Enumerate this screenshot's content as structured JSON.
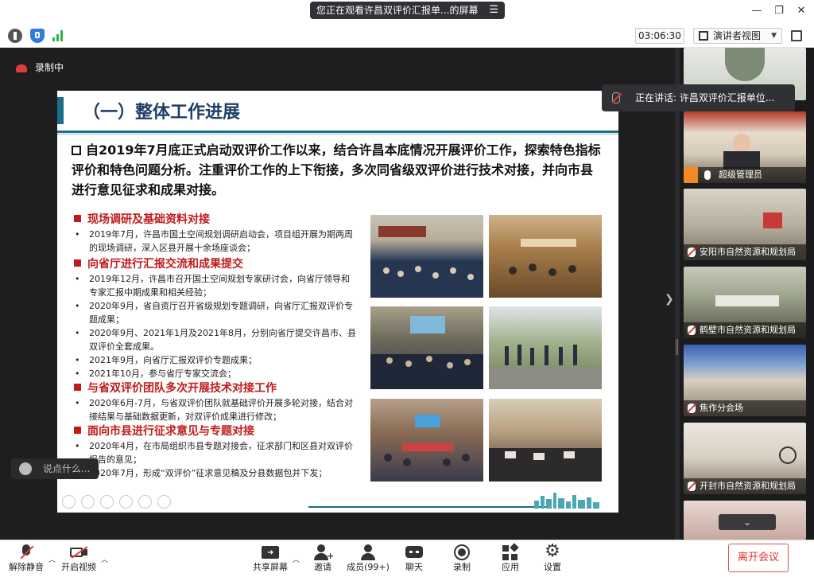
{
  "window": {
    "title": "您正在观看许昌双评价汇报单...的屏幕",
    "minimize_glyph": "—",
    "restore_glyph": "❐",
    "close_glyph": "✕"
  },
  "infobar": {
    "timer": "03:06:30",
    "view_mode": "演讲者视图"
  },
  "recording": {
    "label": "录制中"
  },
  "speaking": {
    "text": "正在讲话: 许昌双评价汇报单位..."
  },
  "slide": {
    "title": "（一）整体工作进展",
    "intro": "自2019年7月底正式启动双评价工作以来，结合许昌本底情况开展评价工作，探索特色指标评价和特色问题分析。注重评价工作的上下衔接，多次同省级双评价进行技术对接，并向市县进行意见征求和成果对接。",
    "sections": [
      {
        "heading": "现场调研及基础资料对接",
        "items": [
          "2019年7月，许昌市国土空间规划调研启动会，项目组开展为期两周的现场调研，深入区县开展十余场座谈会；"
        ]
      },
      {
        "heading": "向省厅进行汇报交流和成果提交",
        "items": [
          "2019年12月，许昌市召开国土空间规划专家研讨会，向省厅领导和专家汇报中期成果和相关经验；",
          "2020年9月，省自资厅召开省级规划专题调研，向省厅汇报双评价专题成果；",
          "2020年9月、2021年1月及2021年8月，分别向省厅提交许昌市、县双评价全套成果。",
          "2021年9月，向省厅汇报双评价专题成果；",
          "2021年10月，参与省厅专家交流会；"
        ]
      },
      {
        "heading": "与省双评价团队多次开展技术对接工作",
        "items": [
          "2020年6月-7月，与省双评价团队就基础评价开展多轮对接，结合对接结果与基础数据更新，对双评价成果进行修改；"
        ]
      },
      {
        "heading": "面向市县进行征求意见与专题对接",
        "items": [
          "2020年4月，在市局组织市县专题对接会，征求部门和区县对双评价报告的意见；",
          "2020年7月，形成“双评价”征求意见稿及分县数据包并下发；"
        ]
      }
    ]
  },
  "chat": {
    "placeholder": "说点什么..."
  },
  "participants": [
    {
      "name": ""
    },
    {
      "name": "超级管理员"
    },
    {
      "name": "安阳市自然资源和规划局"
    },
    {
      "name": "鹤壁市自然资源和规划局"
    },
    {
      "name": "焦作分会场"
    },
    {
      "name": "开封市自然资源和规划局"
    },
    {
      "name": ""
    }
  ],
  "toolbar": {
    "unmute": "解除静音",
    "start_video": "开启视频",
    "share_screen": "共享屏幕",
    "invite": "邀请",
    "members": "成员(99+)",
    "chat": "聊天",
    "record": "录制",
    "apps": "应用",
    "settings": "设置",
    "leave": "离开会议"
  },
  "colors": {
    "slide_title": "#1e3e66",
    "section_red": "#c11a1a",
    "accent_teal": "#1b6f86",
    "leave_red": "#e03030"
  }
}
